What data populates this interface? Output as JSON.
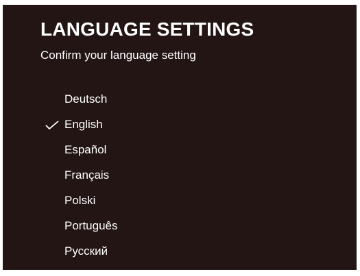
{
  "screen": {
    "title": "LANGUAGE SETTINGS",
    "subtitle": "Confirm your language setting"
  },
  "languages": [
    {
      "label": "Deutsch",
      "selected": false
    },
    {
      "label": "English",
      "selected": true
    },
    {
      "label": "Español",
      "selected": false
    },
    {
      "label": "Français",
      "selected": false
    },
    {
      "label": "Polski",
      "selected": false
    },
    {
      "label": "Português",
      "selected": false
    },
    {
      "label": "Русский",
      "selected": false
    }
  ],
  "colors": {
    "background": "#221514",
    "text": "#ffffff"
  },
  "icons": {
    "selected_marker": "check-icon"
  }
}
